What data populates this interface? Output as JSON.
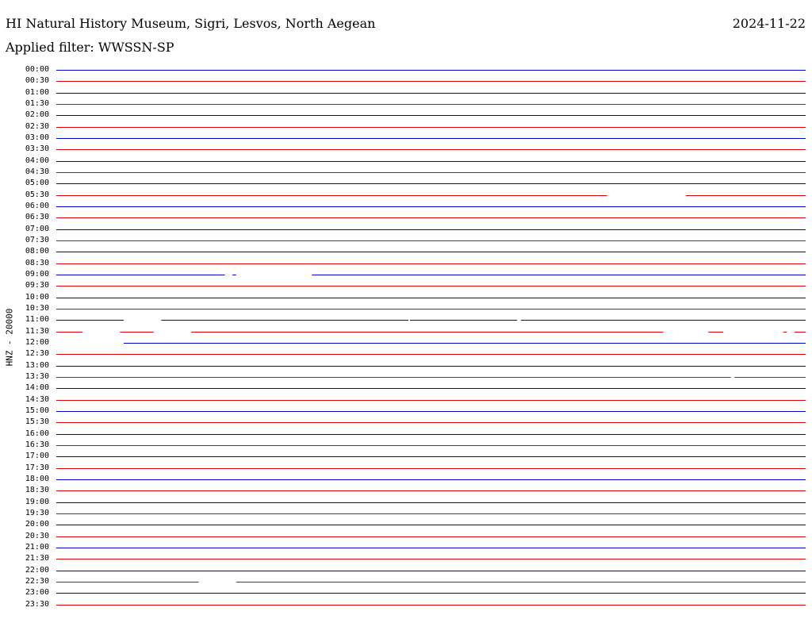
{
  "header": {
    "title": "HI Natural History Museum, Sigri, Lesvos, North Aegean",
    "date": "2024-11-22",
    "filter_label": "Applied filter: WWSSN-SP"
  },
  "chart_data": {
    "type": "line",
    "title": "HI Natural History Museum, Sigri, Lesvos, North Aegean",
    "ylabel": "HNZ - 20000",
    "xlabel": "",
    "colors": [
      "#0000cc",
      "#dd0000"
    ],
    "rows": [
      {
        "time": "00:00",
        "gaps": []
      },
      {
        "time": "00:30",
        "gaps": []
      },
      {
        "time": "01:00",
        "gaps": []
      },
      {
        "time": "01:30",
        "gaps": []
      },
      {
        "time": "02:00",
        "gaps": []
      },
      {
        "time": "02:30",
        "gaps": []
      },
      {
        "time": "03:00",
        "gaps": []
      },
      {
        "time": "03:30",
        "gaps": []
      },
      {
        "time": "04:00",
        "gaps": []
      },
      {
        "time": "04:30",
        "gaps": []
      },
      {
        "time": "05:00",
        "gaps": []
      },
      {
        "time": "05:30",
        "gaps": [
          [
            0.735,
            0.84
          ]
        ]
      },
      {
        "time": "06:00",
        "gaps": []
      },
      {
        "time": "06:30",
        "gaps": []
      },
      {
        "time": "07:00",
        "gaps": []
      },
      {
        "time": "07:30",
        "gaps": []
      },
      {
        "time": "08:00",
        "gaps": []
      },
      {
        "time": "08:30",
        "gaps": []
      },
      {
        "time": "09:00",
        "gaps": [
          [
            0.225,
            0.235
          ],
          [
            0.24,
            0.341
          ]
        ]
      },
      {
        "time": "09:30",
        "gaps": []
      },
      {
        "time": "10:00",
        "gaps": []
      },
      {
        "time": "10:30",
        "gaps": []
      },
      {
        "time": "11:00",
        "gaps": [
          [
            0.09,
            0.14
          ],
          [
            0.47,
            0.472
          ],
          [
            0.615,
            0.62
          ]
        ]
      },
      {
        "time": "11:30",
        "gaps": [
          [
            0.035,
            0.085
          ],
          [
            0.13,
            0.18
          ],
          [
            0.81,
            0.87
          ],
          [
            0.89,
            0.97
          ],
          [
            0.975,
            0.985
          ]
        ]
      },
      {
        "time": "12:00",
        "gaps": [
          [
            0.0,
            0.09
          ]
        ]
      },
      {
        "time": "12:30",
        "gaps": []
      },
      {
        "time": "13:00",
        "gaps": []
      },
      {
        "time": "13:30",
        "gaps": [
          [
            0.9,
            0.905
          ]
        ]
      },
      {
        "time": "14:00",
        "gaps": []
      },
      {
        "time": "14:30",
        "gaps": []
      },
      {
        "time": "15:00",
        "gaps": []
      },
      {
        "time": "15:30",
        "gaps": []
      },
      {
        "time": "16:00",
        "gaps": []
      },
      {
        "time": "16:30",
        "gaps": []
      },
      {
        "time": "17:00",
        "gaps": []
      },
      {
        "time": "17:30",
        "gaps": []
      },
      {
        "time": "18:00",
        "gaps": []
      },
      {
        "time": "18:30",
        "gaps": []
      },
      {
        "time": "19:00",
        "gaps": []
      },
      {
        "time": "19:30",
        "gaps": []
      },
      {
        "time": "20:00",
        "gaps": []
      },
      {
        "time": "20:30",
        "gaps": []
      },
      {
        "time": "21:00",
        "gaps": []
      },
      {
        "time": "21:30",
        "gaps": []
      },
      {
        "time": "22:00",
        "gaps": []
      },
      {
        "time": "22:30",
        "gaps": [
          [
            0.19,
            0.24
          ]
        ]
      },
      {
        "time": "23:00",
        "gaps": []
      },
      {
        "time": "23:30",
        "gaps": []
      }
    ]
  }
}
